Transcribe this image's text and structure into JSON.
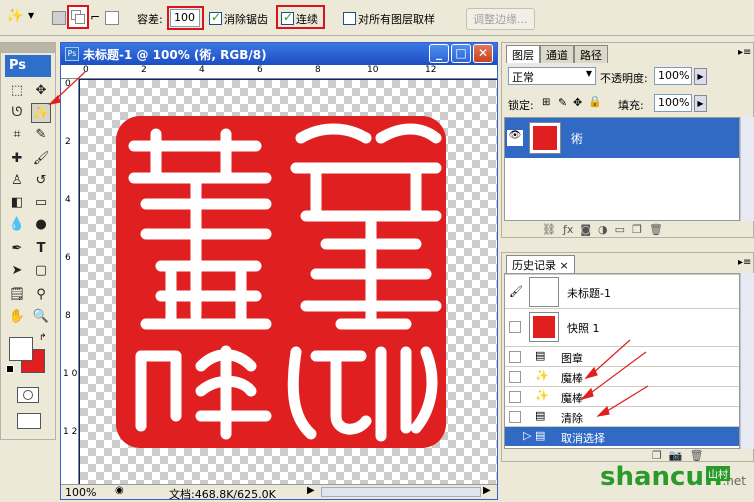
{
  "options_bar": {
    "tolerance_label": "容差:",
    "tolerance_value": "100",
    "antialias_label": "消除锯齿",
    "contiguous_label": "连续",
    "sample_all_label": "对所有图层取样",
    "refine_edge_label": "调整边缘..."
  },
  "toolbox": {
    "logo": "Ps"
  },
  "document": {
    "title": "未标题-1 @ 100% (術, RGB/8)",
    "ruler_h": [
      "0",
      "2",
      "4",
      "6",
      "8",
      "10",
      "12"
    ],
    "ruler_v": [
      "0",
      "2",
      "4",
      "6",
      "8",
      "1 0",
      "1 2"
    ],
    "zoom": "100%",
    "doc_info": "文档:468.8K/625.0K",
    "seal_color": "#e02020"
  },
  "layers_panel": {
    "tabs": [
      "图层",
      "通道",
      "路径"
    ],
    "blend_mode": "正常",
    "opacity_label": "不透明度:",
    "opacity_value": "100%",
    "lock_label": "锁定:",
    "fill_label": "填充:",
    "fill_value": "100%",
    "layer_name": "術"
  },
  "history_panel": {
    "tab": "历史记录",
    "snapshot_doc": "未标题-1",
    "snapshot": "快照 1",
    "items": [
      "图章",
      "魔棒",
      "魔棒",
      "清除",
      "取消选择"
    ]
  },
  "watermark": {
    "text": "shancun",
    "suffix": ".net",
    "cn": "山村"
  },
  "colors": {
    "accent_red": "#d8141c",
    "selection_blue": "#316ac5",
    "title_blue": "#1c4ec2"
  }
}
